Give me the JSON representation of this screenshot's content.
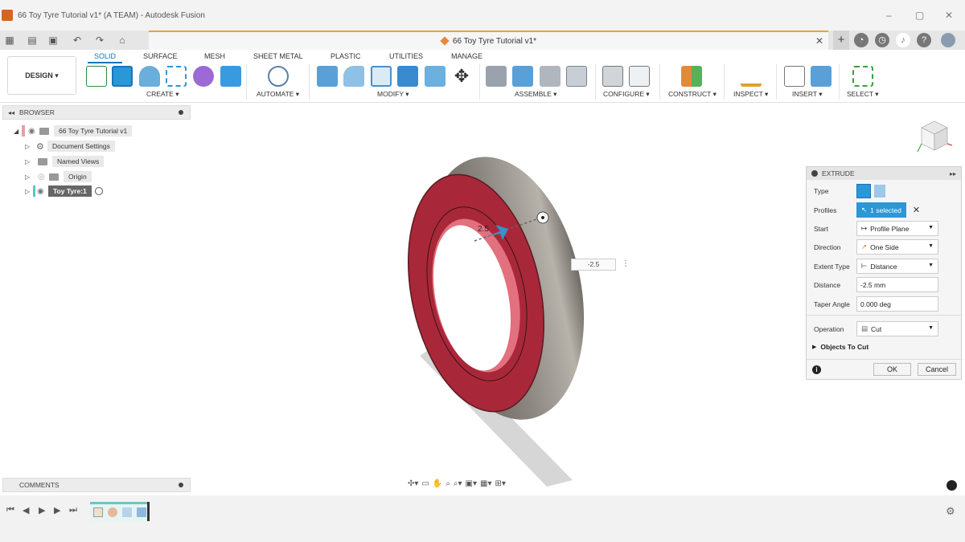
{
  "window": {
    "title": "66 Toy Tyre Tutorial v1* (A TEAM) - Autodesk Fusion",
    "min": "–",
    "max": "▢",
    "close": "✕"
  },
  "tabbar": {
    "doc_tab": "66 Toy Tyre Tutorial v1*",
    "close": "✕",
    "plus": "+"
  },
  "ribbon": {
    "workspace": "DESIGN ▾",
    "tabs": [
      "SOLID",
      "SURFACE",
      "MESH",
      "SHEET METAL",
      "PLASTIC",
      "UTILITIES",
      "MANAGE"
    ],
    "groups": [
      "CREATE ▾",
      "AUTOMATE ▾",
      "MODIFY ▾",
      "ASSEMBLE ▾",
      "CONFIGURE ▾",
      "CONSTRUCT ▾",
      "INSPECT ▾",
      "INSERT ▾",
      "SELECT ▾"
    ]
  },
  "browser": {
    "title": "BROWSER",
    "items": [
      "66 Toy Tyre Tutorial v1",
      "Document Settings",
      "Named Views",
      "Origin",
      "Toy Tyre:1"
    ]
  },
  "comments": {
    "title": "COMMENTS"
  },
  "viewport": {
    "dimension_value": "-2.5",
    "arrow_label": "2.5"
  },
  "extrude": {
    "title": "EXTRUDE",
    "rows": {
      "type": {
        "label": "Type"
      },
      "profiles": {
        "label": "Profiles",
        "value": "1 selected"
      },
      "start": {
        "label": "Start",
        "value": "Profile Plane"
      },
      "direction": {
        "label": "Direction",
        "value": "One Side"
      },
      "extent": {
        "label": "Extent Type",
        "value": "Distance"
      },
      "distance": {
        "label": "Distance",
        "value": "-2.5 mm"
      },
      "taper": {
        "label": "Taper Angle",
        "value": "0.000 deg"
      },
      "operation": {
        "label": "Operation",
        "value": "Cut"
      }
    },
    "objects_to_cut": "Objects To Cut",
    "ok": "OK",
    "cancel": "Cancel"
  },
  "colors": {
    "accent": "#1a74bb",
    "tyre": "#7a7670",
    "cut_face": "#a8283a",
    "selected": "#2a97d6"
  }
}
